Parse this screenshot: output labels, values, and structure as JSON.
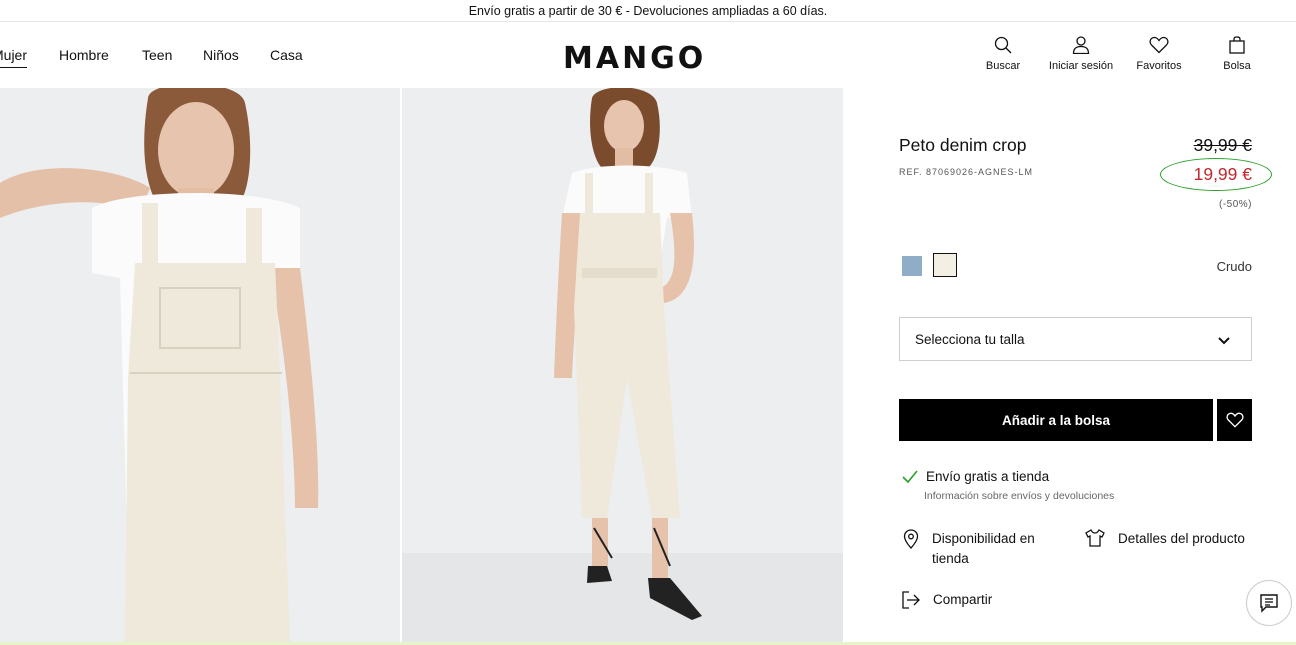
{
  "banner": {
    "text": "Envío gratis a partir de 30 € - Devoluciones ampliadas a 60 días."
  },
  "nav": {
    "items": [
      "Mujer",
      "Hombre",
      "Teen",
      "Niños",
      "Casa"
    ],
    "active": "Mujer"
  },
  "logo": "MANGO",
  "tools": [
    {
      "label": "Buscar",
      "icon": "search-icon"
    },
    {
      "label": "Iniciar sesión",
      "icon": "user-icon"
    },
    {
      "label": "Favoritos",
      "icon": "heart-icon"
    },
    {
      "label": "Bolsa",
      "icon": "bag-icon"
    }
  ],
  "product": {
    "title": "Peto denim crop",
    "ref": "REF. 87069026-AGNES-LM",
    "old_price": "39,99 €",
    "new_price": "19,99 €",
    "discount": "(-50%)",
    "color_name": "Crudo",
    "swatches": [
      {
        "name": "blue",
        "color": "#90adc7"
      },
      {
        "name": "cream",
        "color": "#f4efe4",
        "selected": true
      }
    ],
    "size_placeholder": "Selecciona tu talla",
    "add_label": "Añadir a la bolsa"
  },
  "shipping": {
    "title": "Envío gratis a tienda",
    "sub": "Información sobre envíos y devoluciones"
  },
  "actions": {
    "availability": "Disponibilidad en tienda",
    "details": "Detalles del producto",
    "share": "Compartir"
  },
  "colors": {
    "sale": "#c0282e",
    "highlight_ring": "#2ca02c",
    "button": "#000000"
  }
}
